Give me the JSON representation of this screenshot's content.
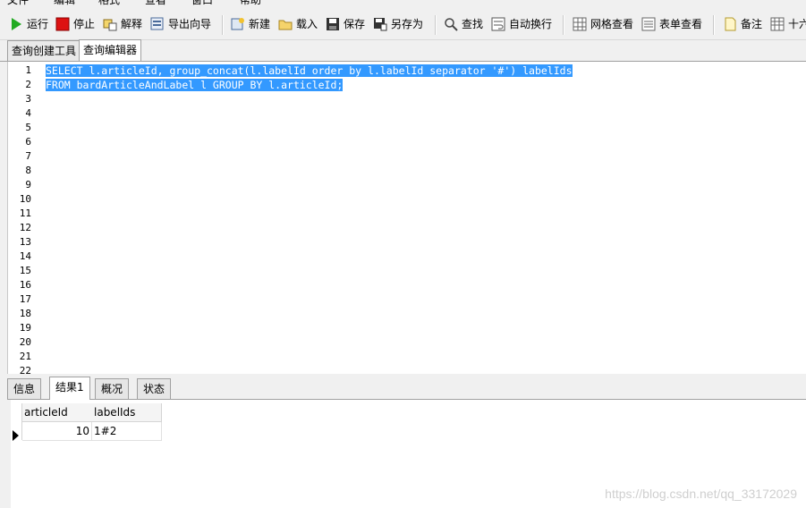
{
  "menu": {
    "items": [
      "文件",
      "编辑",
      "格式",
      "查看",
      "窗口",
      "帮助"
    ]
  },
  "toolbar": {
    "run": "运行",
    "stop": "停止",
    "explain": "解释",
    "export_wizard": "导出向导",
    "new": "新建",
    "load": "载入",
    "save": "保存",
    "save_as": "另存为",
    "find": "查找",
    "word_wrap": "自动换行",
    "grid_view": "网格查看",
    "form_view": "表单查看",
    "memo": "备注",
    "hex": "十六"
  },
  "query_tabs": [
    "查询创建工具",
    "查询编辑器"
  ],
  "editor": {
    "line_numbers": [
      "1",
      "2",
      "3",
      "4",
      "5",
      "6",
      "7",
      "8",
      "9",
      "10",
      "11",
      "12",
      "13",
      "14",
      "15",
      "16",
      "17",
      "18",
      "19",
      "20",
      "21",
      "22"
    ],
    "lines": [
      "SELECT l.articleId, group_concat(l.labelId order by l.labelId separator '#') labelIds",
      "FROM bardArticleAndLabel l GROUP BY l.articleId;"
    ]
  },
  "result_tabs": [
    "信息",
    "结果1",
    "概况",
    "状态"
  ],
  "grid": {
    "columns": [
      "articleId",
      "labelIds"
    ],
    "rows": [
      {
        "articleId": "10",
        "labelIds": "1#2"
      }
    ]
  },
  "watermark": "https://blog.csdn.net/qq_33172029",
  "colors": {
    "selection": "#3399ff",
    "run_icon": "#22aa22",
    "stop_icon": "#dd1111"
  }
}
